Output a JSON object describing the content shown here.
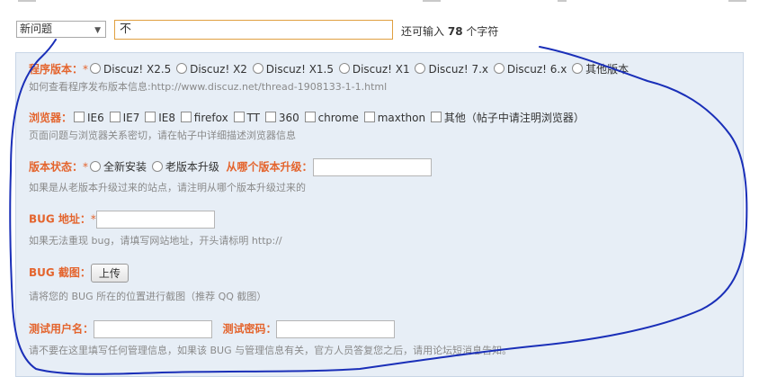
{
  "type_select": {
    "value": "新问题"
  },
  "title_field": {
    "value": "不"
  },
  "counter": {
    "prefix": "还可输入",
    "count": "78",
    "suffix": "个字符"
  },
  "version": {
    "label": "程序版本：",
    "star": "*",
    "options": [
      "Discuz! X2.5",
      "Discuz! X2",
      "Discuz! X1.5",
      "Discuz! X1",
      "Discuz! 7.x",
      "Discuz! 6.x",
      "其他版本"
    ],
    "hint": "如何查看程序发布版本信息:http://www.discuz.net/thread-1908133-1-1.html"
  },
  "browser": {
    "label": "浏览器：",
    "options": [
      "IE6",
      "IE7",
      "IE8",
      "firefox",
      "TT",
      "360",
      "chrome",
      "maxthon",
      "其他（帖子中请注明浏览器）"
    ],
    "hint": "页面问题与浏览器关系密切，请在帖子中详细描述浏览器信息"
  },
  "install": {
    "label": "版本状态：",
    "star": "*",
    "options": [
      "全新安装",
      "老版本升级"
    ],
    "from_label": "从哪个版本升级：",
    "hint": "如果是从老版本升级过来的站点，请注明从哪个版本升级过来的"
  },
  "bug_url": {
    "label": "BUG 地址：",
    "star": "*",
    "hint": "如果无法重现 bug，请填写网站地址，开头请标明 http://"
  },
  "screenshot": {
    "label": "BUG 截图：",
    "button": "上传",
    "hint": "请将您的 BUG 所在的位置进行截图（推荐 QQ 截图）"
  },
  "test_account": {
    "user_label": "测试用户名：",
    "pass_label": "测试密码：",
    "hint": "请不要在这里填写任何管理信息，如果该 BUG 与管理信息有关，官方人员答复您之后，请用论坛短消息告知。"
  },
  "colors": {
    "label": "#e4642d",
    "panel": "#e7eef6",
    "scribble": "#1a2fb8"
  }
}
